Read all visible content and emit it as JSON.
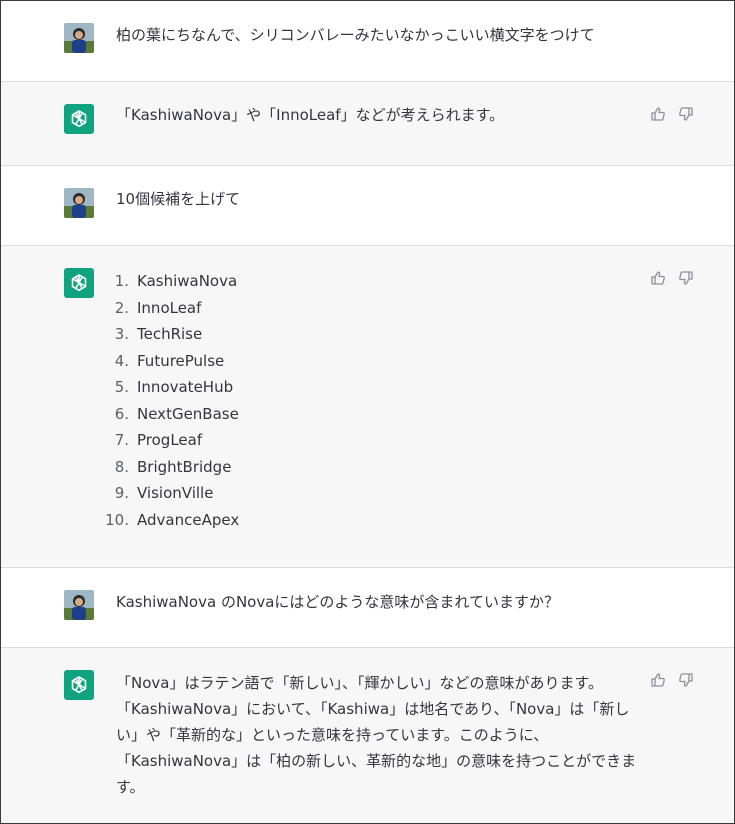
{
  "messages": [
    {
      "role": "user",
      "text": "柏の葉にちなんで、シリコンバレーみたいなかっこいい横文字をつけて"
    },
    {
      "role": "assistant",
      "text": "「KashiwaNova」や「InnoLeaf」などが考えられます。"
    },
    {
      "role": "user",
      "text": "10個候補を上げて"
    },
    {
      "role": "assistant",
      "list": [
        {
          "num": "1.",
          "text": "KashiwaNova"
        },
        {
          "num": "2.",
          "text": "InnoLeaf"
        },
        {
          "num": "3.",
          "text": "TechRise"
        },
        {
          "num": "4.",
          "text": "FuturePulse"
        },
        {
          "num": "5.",
          "text": "InnovateHub"
        },
        {
          "num": "6.",
          "text": "NextGenBase"
        },
        {
          "num": "7.",
          "text": "ProgLeaf"
        },
        {
          "num": "8.",
          "text": "BrightBridge"
        },
        {
          "num": "9.",
          "text": "VisionVille"
        },
        {
          "num": "10.",
          "text": "AdvanceApex"
        }
      ]
    },
    {
      "role": "user",
      "text": "KashiwaNova のNovaにはどのような意味が含まれていますか？"
    },
    {
      "role": "assistant",
      "text": "「Nova」はラテン語で「新しい」、「輝かしい」などの意味があります。\n「KashiwaNova」において、「Kashiwa」は地名であり、「Nova」は「新し\nい」や「革新的な」といった意味を持っています。このように、\n「KashiwaNova」は「柏の新しい、革新的な地」の意味を持つことができま\nす。"
    }
  ],
  "icons": {
    "user_avatar": "user-avatar-photo",
    "assistant_avatar": "openai-logo-icon",
    "like": "thumbs-up-icon",
    "dislike": "thumbs-down-icon"
  },
  "colors": {
    "assistant_bg": "#f7f7f8",
    "logo_bg": "#10a37f",
    "text": "#343541"
  }
}
